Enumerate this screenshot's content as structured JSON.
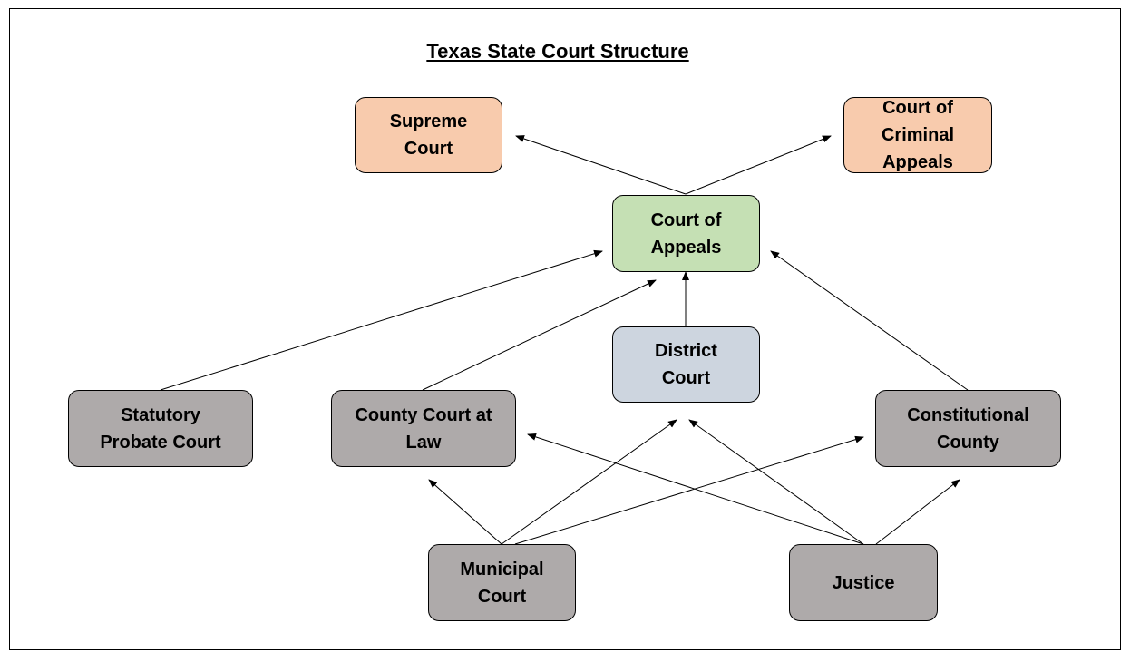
{
  "title": "Texas State Court Structure",
  "colors": {
    "top_courts": "#f8cbad",
    "appeals": "#c5e0b4",
    "district": "#cdd5df",
    "lower_courts": "#aeaaaa"
  },
  "nodes": {
    "supreme_court": "Supreme\nCourt",
    "criminal_appeals": "Court of\nCriminal\nAppeals",
    "court_of_appeals": "Court of\nAppeals",
    "district_court": "District\nCourt",
    "statutory_probate": "Statutory\nProbate Court",
    "county_court_at_law": "County Court at\nLaw",
    "constitutional_county": "Constitutional\nCounty",
    "municipal_court": "Municipal\nCourt",
    "justice": "Justice"
  },
  "edges": [
    {
      "from": "court_of_appeals",
      "to": "supreme_court"
    },
    {
      "from": "court_of_appeals",
      "to": "criminal_appeals"
    },
    {
      "from": "district_court",
      "to": "court_of_appeals"
    },
    {
      "from": "statutory_probate",
      "to": "court_of_appeals"
    },
    {
      "from": "county_court_at_law",
      "to": "court_of_appeals"
    },
    {
      "from": "constitutional_county",
      "to": "court_of_appeals"
    },
    {
      "from": "municipal_court",
      "to": "county_court_at_law"
    },
    {
      "from": "municipal_court",
      "to": "district_court"
    },
    {
      "from": "municipal_court",
      "to": "constitutional_county"
    },
    {
      "from": "justice",
      "to": "county_court_at_law"
    },
    {
      "from": "justice",
      "to": "district_court"
    },
    {
      "from": "justice",
      "to": "constitutional_county"
    }
  ]
}
